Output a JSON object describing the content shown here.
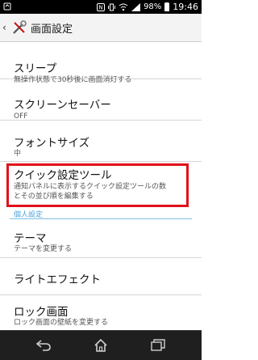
{
  "status_bar": {
    "battery": "98%",
    "time": "19:46"
  },
  "app_bar": {
    "title": "画面設定"
  },
  "settings": [
    {
      "title": "スリープ",
      "subtitle": "無操作状態で30秒後に画面消灯する"
    },
    {
      "title": "スクリーンセーバー",
      "subtitle": "OFF"
    },
    {
      "title": "フォントサイズ",
      "subtitle": "中"
    },
    {
      "title": "クイック設定ツール",
      "subtitle_line1": "通知パネルに表示するクイック設定ツールの数",
      "subtitle_line2": "とその並び順を編集する"
    }
  ],
  "section_personal": {
    "header": "個人設定",
    "items": [
      {
        "title": "テーマ",
        "subtitle": "テーマを変更する"
      },
      {
        "title": "ライトエフェクト"
      },
      {
        "title": "ロック画面",
        "subtitle": "ロック画面の壁紙を変更する"
      }
    ]
  },
  "colors": {
    "highlight": "#e0101a",
    "section_accent": "#4aa3d9"
  }
}
